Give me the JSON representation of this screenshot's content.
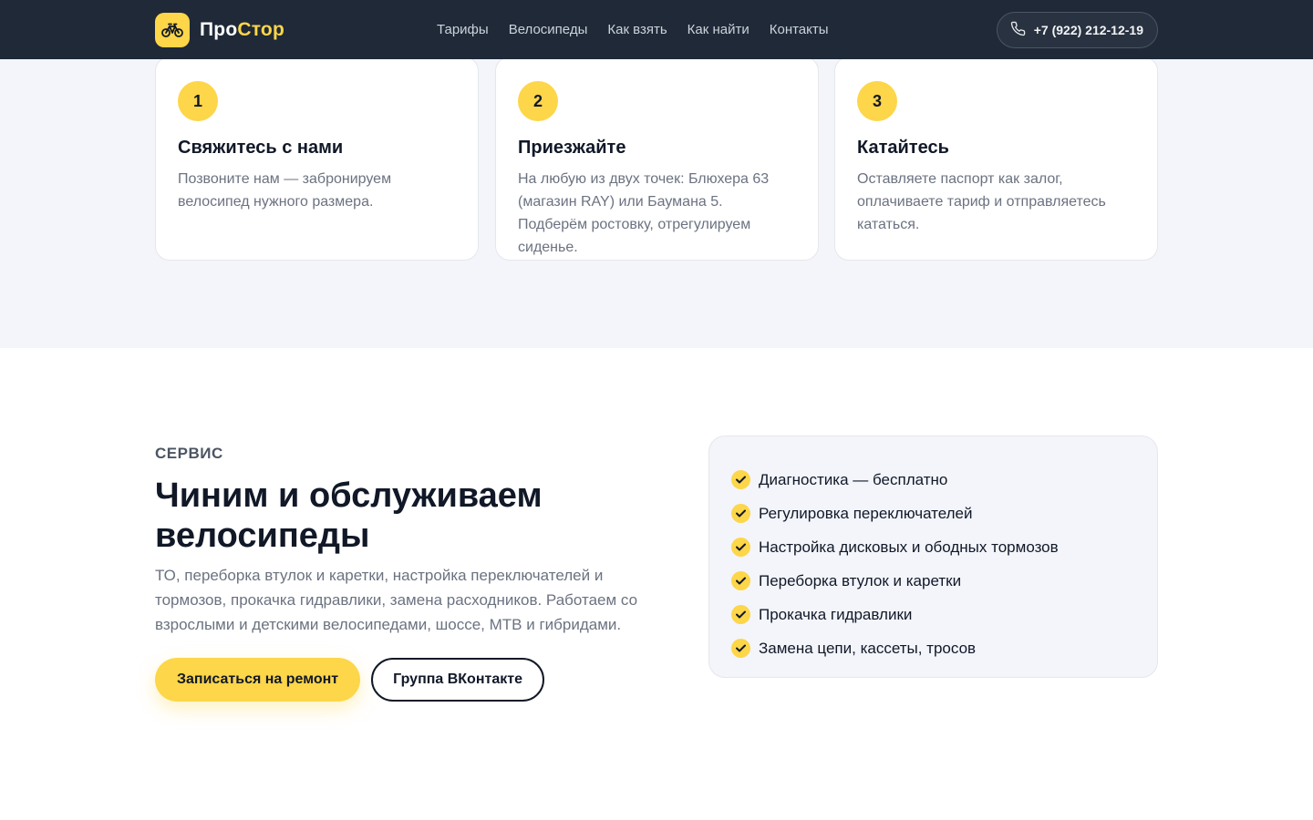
{
  "header": {
    "brand": {
      "part1": "Про",
      "part2": "Стор",
      "icon": "bicycle-icon"
    },
    "nav": [
      "Тарифы",
      "Велосипеды",
      "Как взять",
      "Как найти",
      "Контакты"
    ],
    "phone": {
      "icon": "phone-icon",
      "label": "+7 (922) 212-12-19"
    }
  },
  "steps": [
    {
      "num": "1",
      "title": "Свяжитесь с нами",
      "text": "Позвоните нам — забронируем велосипед нужного размера."
    },
    {
      "num": "2",
      "title": "Приезжайте",
      "text": "На любую из двух точек: Блюхера 63 (магазин RAY) или Баумана 5. Подберём ростовку, отрегулируем сиденье."
    },
    {
      "num": "3",
      "title": "Катайтесь",
      "text": "Оставляете паспорт как залог, оплачиваете тариф и отправляетесь кататься."
    }
  ],
  "service": {
    "eyebrow": "СЕРВИС",
    "title_line1": "Чиним и обслуживаем",
    "title_line2": "велосипеды",
    "description": "ТО, переборка втулок и каретки, настройка переключателей и тормозов, прокачка гидравлики, замена расходников. Работаем со взрослыми и детскими велосипедами, шоссе, МТВ и гибридами.",
    "primary_button": "Записаться на ремонт",
    "secondary_button": "Группа ВКонтакте",
    "checklist": [
      "Диагностика — бесплатно",
      "Регулировка переключателей",
      "Настройка дисковых и ободных тормозов",
      "Переборка втулок и каретки",
      "Прокачка гидравлики",
      "Замена цепи, кассеты, тросов"
    ]
  },
  "colors": {
    "accent": "#fdd649",
    "header_bg": "#1f2937",
    "section_bg": "#f3f5fb"
  }
}
